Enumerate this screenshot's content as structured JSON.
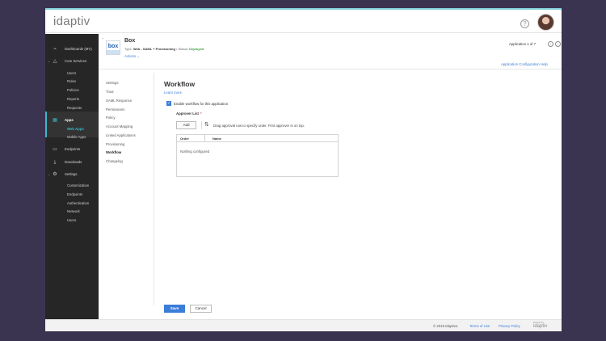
{
  "header": {
    "logo_text": "idaptiv",
    "help_glyph": "?",
    "icons": {
      "help": "help-circle-icon",
      "avatar": "user-avatar"
    }
  },
  "sidebar": {
    "items": [
      {
        "label": "Dashboards (MV)",
        "icon": "⌁"
      },
      {
        "label": "Core Services",
        "icon": "△",
        "chevron": "⌄"
      },
      {
        "label": "Users"
      },
      {
        "label": "Roles"
      },
      {
        "label": "Policies"
      },
      {
        "label": "Reports"
      },
      {
        "label": "Requests"
      },
      {
        "label": "Apps",
        "icon": "▦"
      },
      {
        "label": "Web Apps"
      },
      {
        "label": "Mobile Apps"
      },
      {
        "label": "Endpoints",
        "icon": "▭"
      },
      {
        "label": "Downloads",
        "icon": "⤓"
      },
      {
        "label": "Settings",
        "icon": "⚙",
        "chevron": "⌄"
      },
      {
        "label": "Customization"
      },
      {
        "label": "Endpoints"
      },
      {
        "label": "Authentication"
      },
      {
        "label": "Network"
      },
      {
        "label": "Users"
      }
    ]
  },
  "app": {
    "back": "←",
    "logo_text": "box",
    "name": "Box",
    "type_label": "Type:",
    "type_value": "Web - SAML + Provisioning",
    "status_label": "Status:",
    "status_value": "Deployed",
    "actions_label": "Actions",
    "actions_chevron": "⌄",
    "count": "Application 1 of 7",
    "prev": "‹",
    "next": "›",
    "config_help": "Application Configuration Help"
  },
  "subnav": [
    "Settings",
    "Trust",
    "SAML Response",
    "Permissions",
    "Policy",
    "Account Mapping",
    "Linked Applications",
    "Provisioning",
    "Workflow",
    "Changelog"
  ],
  "workflow": {
    "title": "Workflow",
    "learn_more": "Learn more",
    "checkbox_check": "✓",
    "enable_label": "Enable workflow for this application",
    "approver_label": "Approver List",
    "required_mark": "*",
    "add_label": "Add",
    "drag_icon": "⇅",
    "drag_hint": "Drag approval row to specify order. First approver is on top.",
    "columns": [
      "Order",
      "Name"
    ],
    "empty_text": "Nothing configured"
  },
  "footer": {
    "save_label": "Save",
    "cancel_label": "Cancel",
    "copyright": "© 2019 Idaptive.",
    "terms": "Terms of Use",
    "privacy": "Privacy Policy",
    "powered_by": "Powered by",
    "mini_logo": "idaptiv"
  },
  "colors": {
    "accent": "#3b7dd8",
    "teal": "#3cb8c8",
    "sidebar_bg": "#262626",
    "status_ok": "#3a9b3a",
    "backdrop": "#3b3450"
  }
}
